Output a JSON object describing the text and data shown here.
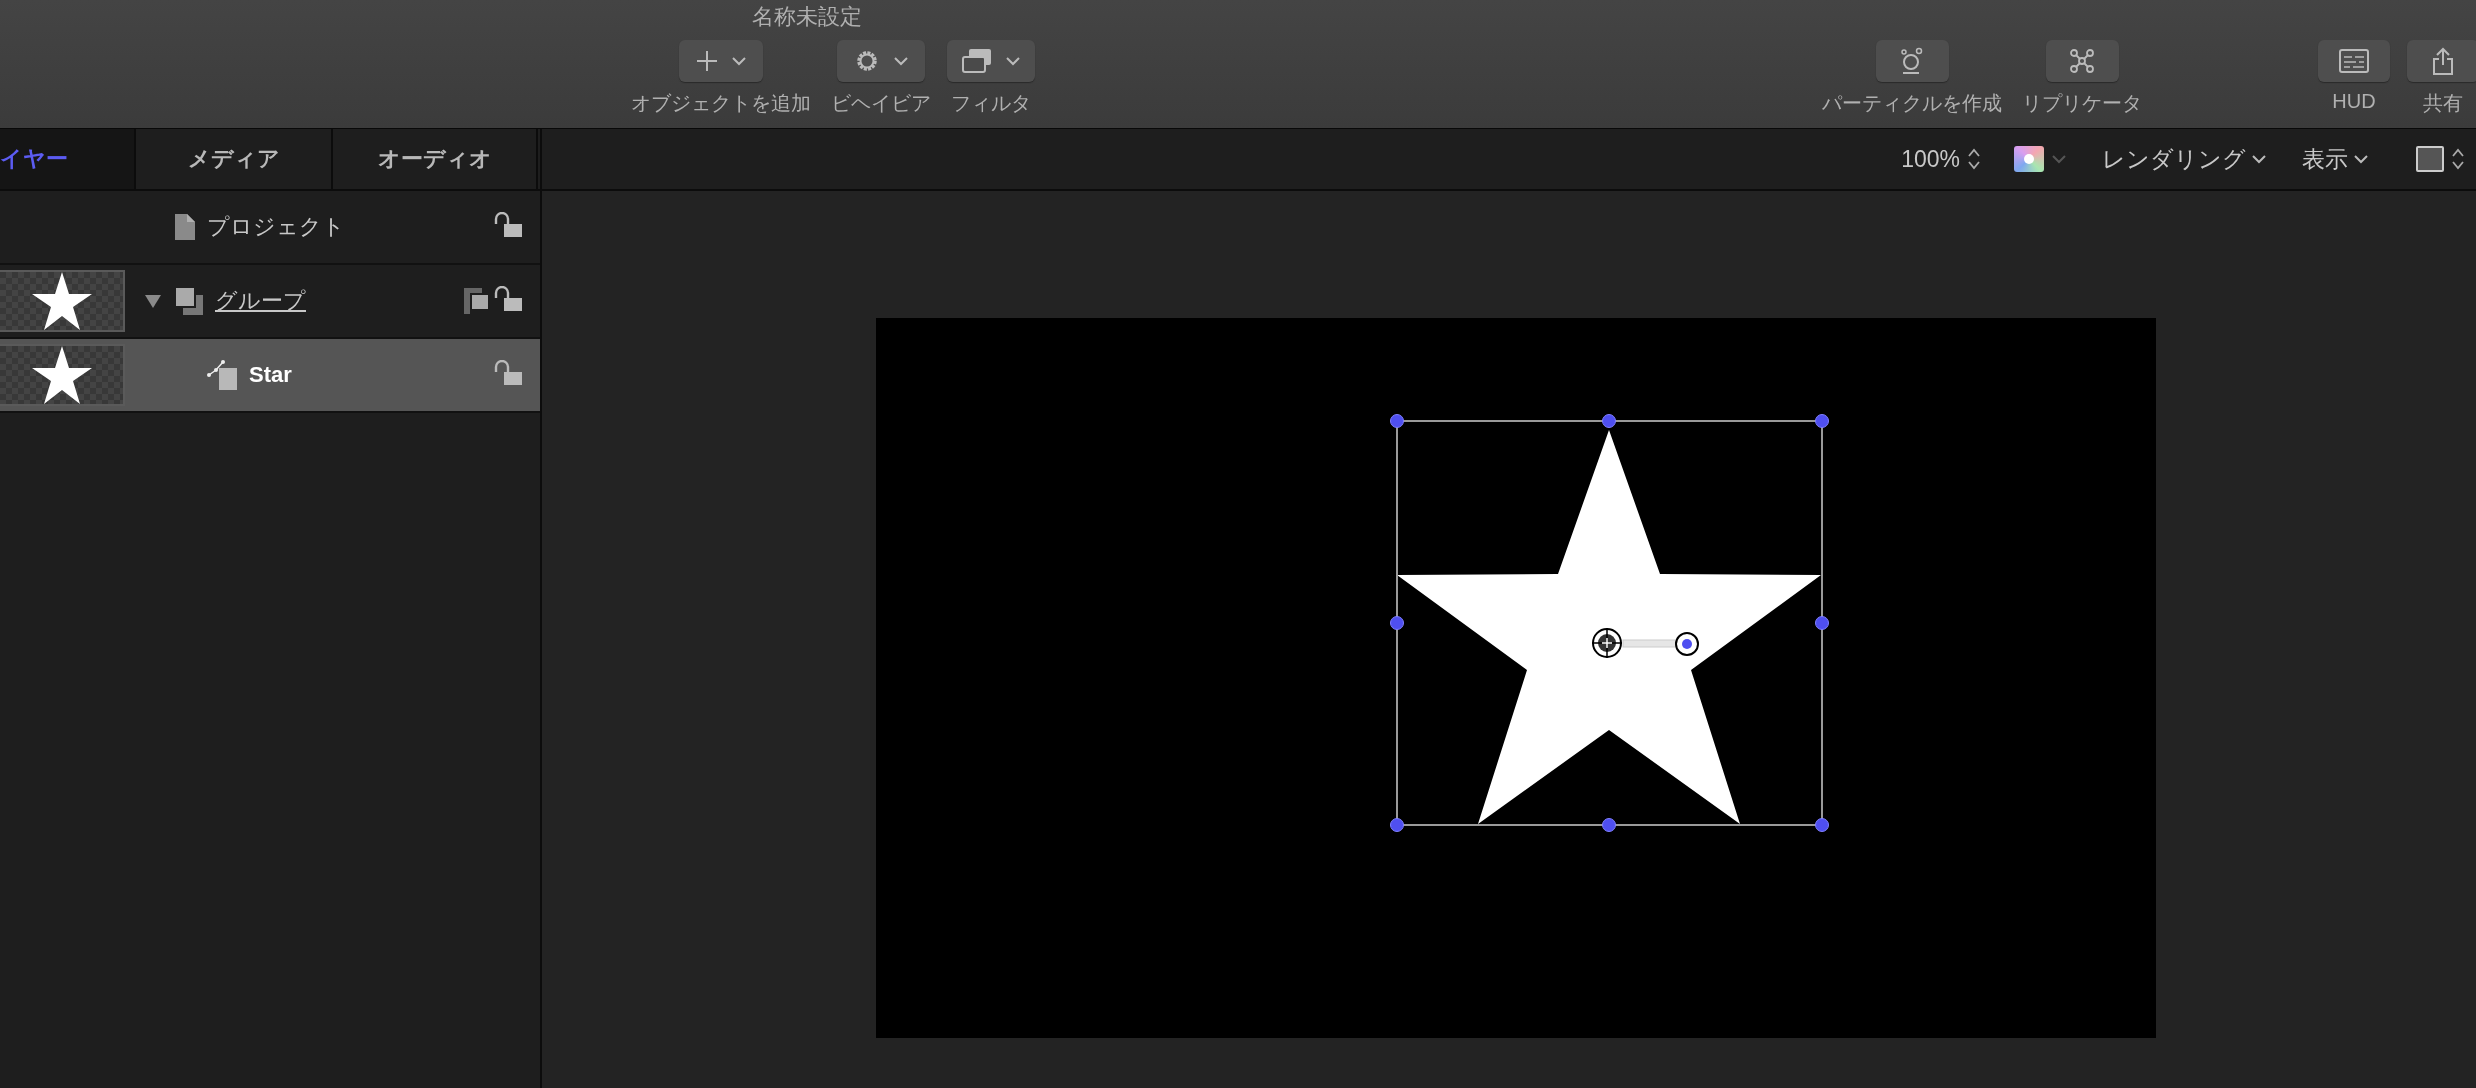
{
  "window": {
    "title": "名称未設定"
  },
  "toolbar": [
    {
      "kind": "add",
      "label": "オブジェクトを追加",
      "has_menu": true
    },
    {
      "kind": "behaviors",
      "label": "ビヘイビア",
      "has_menu": true
    },
    {
      "kind": "filters",
      "label": "フィルタ",
      "has_menu": true
    },
    {
      "kind": "particles",
      "label": "パーティクルを作成",
      "has_menu": false
    },
    {
      "kind": "replicator",
      "label": "リプリケータ",
      "has_menu": false
    },
    {
      "kind": "hud",
      "label": "HUD",
      "has_menu": false
    },
    {
      "kind": "share",
      "label": "共有",
      "has_menu": false
    }
  ],
  "tabs": [
    {
      "label": "イヤー",
      "selected": true
    },
    {
      "label": "メディア",
      "selected": false
    },
    {
      "label": "オーディオ",
      "selected": false
    }
  ],
  "layers": [
    {
      "kind": "project",
      "name": "プロジェクト",
      "selected": false,
      "locked": false
    },
    {
      "kind": "group",
      "name": "グループ",
      "selected": false,
      "locked": false,
      "expanded": true,
      "children": [
        {
          "kind": "shape",
          "name": "Star",
          "selected": true,
          "locked": false
        }
      ]
    }
  ],
  "viewer_bar": {
    "zoom": "100%",
    "menus": [
      "レンダリング",
      "表示"
    ]
  }
}
